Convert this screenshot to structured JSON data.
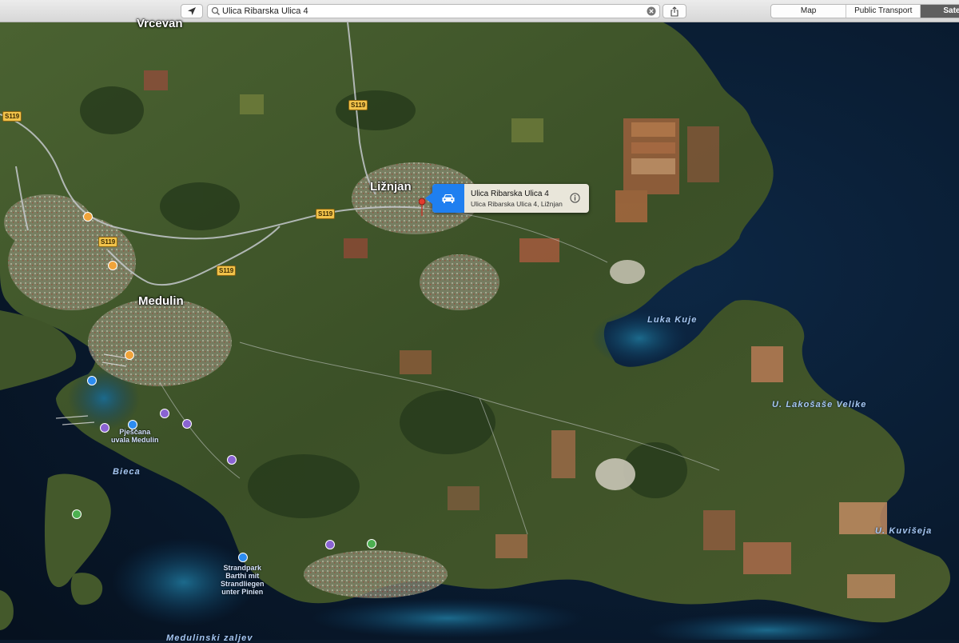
{
  "toolbar": {
    "search": {
      "value": "Ulica Ribarska Ulica 4",
      "search_icon": "magnifier-icon",
      "clear_icon": "clear-x-icon"
    },
    "locate_icon": "location-arrow-icon",
    "share_icon": "share-icon",
    "view_modes": [
      "Map",
      "Public Transport",
      "Sate"
    ],
    "selected_mode": "Sate"
  },
  "map": {
    "place_labels": {
      "vrcevan": "Vrcevan",
      "liznjan": "Ližnjan",
      "medulin": "Medulin",
      "bieca": "Bieca",
      "luka_kuje": "Luka Kuje",
      "lakosase": "U. Lakošaše Velike",
      "kuviseja": "U. Kuvišeja",
      "medulinski": "Medulinski zaljev"
    },
    "poi_labels": {
      "pjescana": "Pješčana\nuvala Medulin",
      "strandpark": "Strandpark\nBarthi mit\nStrandliegen\nunter Pinien"
    },
    "road_shields": [
      "S119",
      "S119",
      "S119",
      "S119",
      "S119"
    ],
    "colors": {
      "sea": "#0a1a2c",
      "land": "#3d5228",
      "shield": "#f1c24a",
      "pin": "#e23b2e"
    }
  },
  "callout": {
    "title": "Ulica Ribarska Ulica 4",
    "subtitle": "Ulica Ribarska Ulica 4, Ližnjan",
    "car_icon": "car-icon",
    "info_icon": "info-icon",
    "accent": "#1f7ff0"
  }
}
